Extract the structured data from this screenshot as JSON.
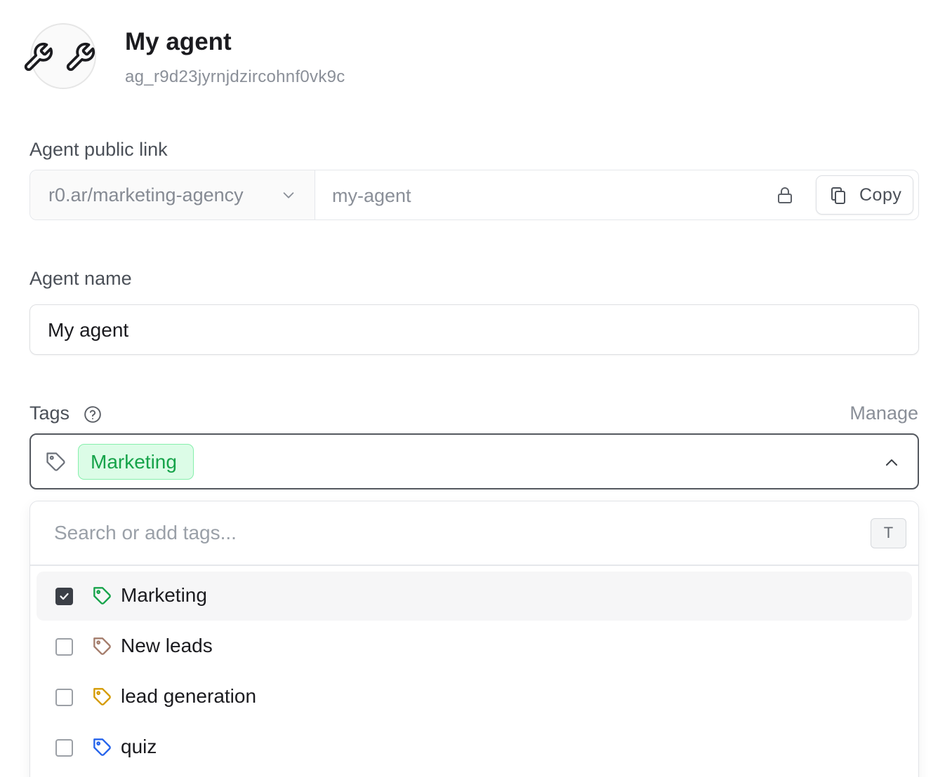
{
  "header": {
    "avatar_icon": "wrench-icon",
    "title": "My agent",
    "agent_id": "ag_r9d23jyrnjdzircohnf0vk9c"
  },
  "public_link": {
    "label": "Agent public link",
    "domain": "r0.ar/marketing-agency",
    "slug_placeholder": "my-agent",
    "copy_label": "Copy"
  },
  "agent_name": {
    "label": "Agent name",
    "value": "My agent"
  },
  "tags": {
    "label": "Tags",
    "manage_label": "Manage",
    "selected": [
      {
        "label": "Marketing",
        "color": "#16a34a"
      }
    ],
    "dropdown": {
      "search_placeholder": "Search or add tags...",
      "shortcut": "T",
      "options": [
        {
          "label": "Marketing",
          "checked": true,
          "color": "#16a34a"
        },
        {
          "label": "New leads",
          "checked": false,
          "color": "#a47c6b"
        },
        {
          "label": "lead generation",
          "checked": false,
          "color": "#d49a00"
        },
        {
          "label": "quiz",
          "checked": false,
          "color": "#2563eb"
        }
      ]
    }
  }
}
